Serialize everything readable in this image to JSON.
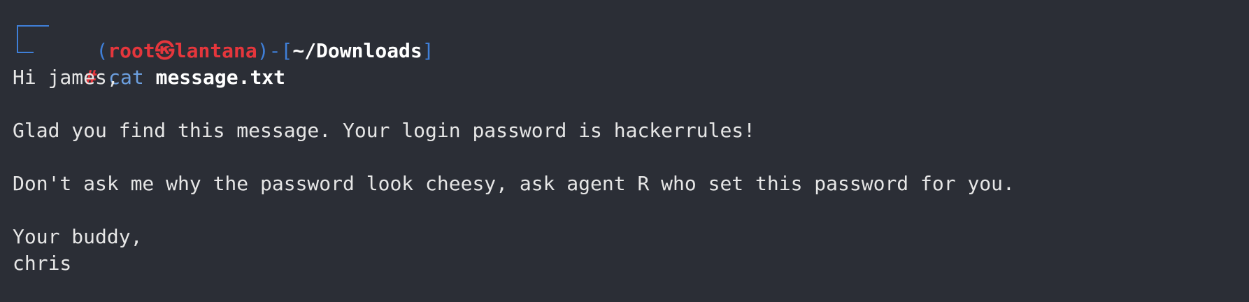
{
  "prompt": {
    "open_paren": "(",
    "user": "root",
    "at_symbol": "㉿",
    "host": "lantana",
    "close_paren": ")",
    "dash": "-",
    "open_bracket": "[",
    "cwd": "~/Downloads",
    "close_bracket": "]",
    "hash": "#",
    "command": "cat",
    "argument": "message.txt"
  },
  "output": {
    "lines": [
      "Hi james,",
      "",
      "Glad you find this message. Your login password is hackerrules!",
      "",
      "Don't ask me why the password look cheesy, ask agent R who set this password for you.",
      "",
      "Your buddy,",
      "chris"
    ]
  },
  "colors": {
    "background": "#2b2e36",
    "prompt_blue": "#3f7fd8",
    "prompt_red": "#e5363c",
    "text": "#e6e6e6"
  }
}
